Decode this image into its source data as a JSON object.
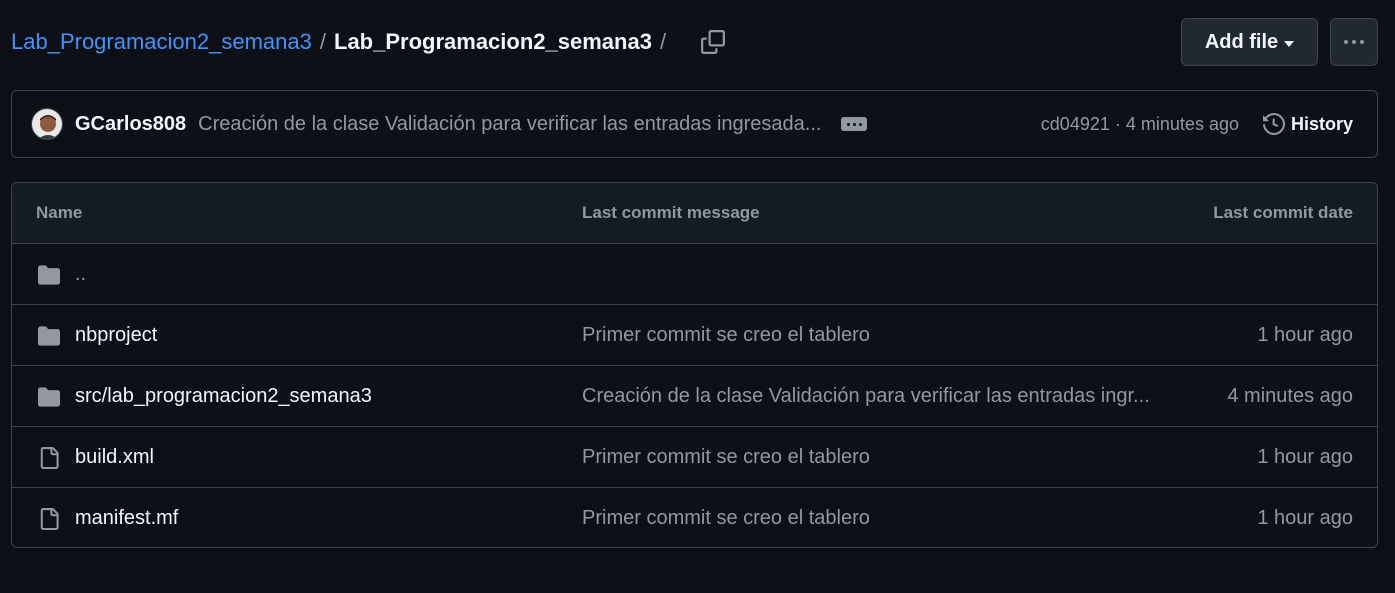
{
  "breadcrumb": {
    "repo": "Lab_Programacion2_semana3",
    "separator": "/",
    "current": "Lab_Programacion2_semana3",
    "trailing_separator": "/"
  },
  "toolbar": {
    "add_file_label": "Add file",
    "copy_icon": "copy-icon",
    "more_icon": "kebab-horizontal-icon"
  },
  "latest_commit": {
    "author": "GCarlos808",
    "message": "Creación de la clase Validación para verificar las entradas ingresada...",
    "sha": "cd04921",
    "dot": "·",
    "time": "4 minutes ago",
    "history_label": "History"
  },
  "table": {
    "headers": {
      "name": "Name",
      "message": "Last commit message",
      "date": "Last commit date"
    },
    "rows": [
      {
        "type": "folder",
        "name": "..",
        "message": "",
        "date": ""
      },
      {
        "type": "folder",
        "name": "nbproject",
        "message": "Primer commit se creo el tablero",
        "date": "1 hour ago"
      },
      {
        "type": "folder",
        "name": "src/lab_programacion2_semana3",
        "message": "Creación de la clase Validación para verificar las entradas ingr...",
        "date": "4 minutes ago"
      },
      {
        "type": "file",
        "name": "build.xml",
        "message": "Primer commit se creo el tablero",
        "date": "1 hour ago"
      },
      {
        "type": "file",
        "name": "manifest.mf",
        "message": "Primer commit se creo el tablero",
        "date": "1 hour ago"
      }
    ]
  },
  "colors": {
    "background": "#0d1117",
    "border": "#3d444d",
    "link": "#4493f8",
    "muted": "#9198a1",
    "text": "#f0f6fc"
  }
}
